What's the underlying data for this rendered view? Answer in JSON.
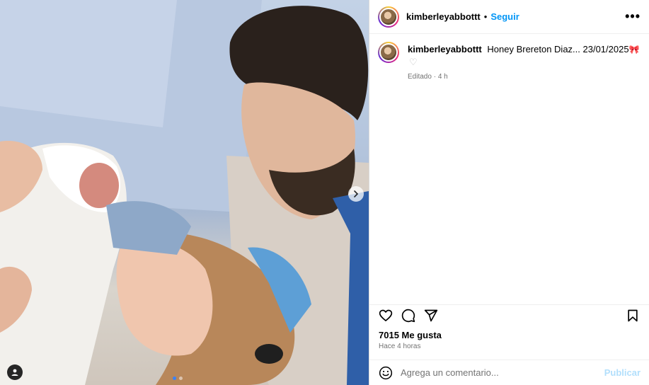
{
  "post": {
    "username": "kimberleyabbottt",
    "follow_label": "Seguir",
    "separator": "•",
    "more_label": "•••"
  },
  "caption": {
    "username": "kimberleyabbottt",
    "text": "Honey Brereton Diaz... 23/01/2025",
    "emoji": "🎀",
    "heart": "♡",
    "edited_label": "Editado",
    "edited_sep": "·",
    "edited_time": "4 h"
  },
  "stats": {
    "likes": "7015 Me gusta",
    "time_ago": "Hace 4 horas"
  },
  "comment": {
    "placeholder": "Agrega un comentario...",
    "publish_label": "Publicar"
  },
  "icons": {
    "like": "heart-icon",
    "comment": "comment-icon",
    "share": "share-icon",
    "save": "bookmark-icon",
    "emoji": "emoji-icon",
    "next": "chevron-right-icon",
    "tag": "user-tag-icon"
  },
  "colors": {
    "accent": "#0095f6",
    "publish_disabled": "#b2dffc",
    "muted": "#737373"
  }
}
